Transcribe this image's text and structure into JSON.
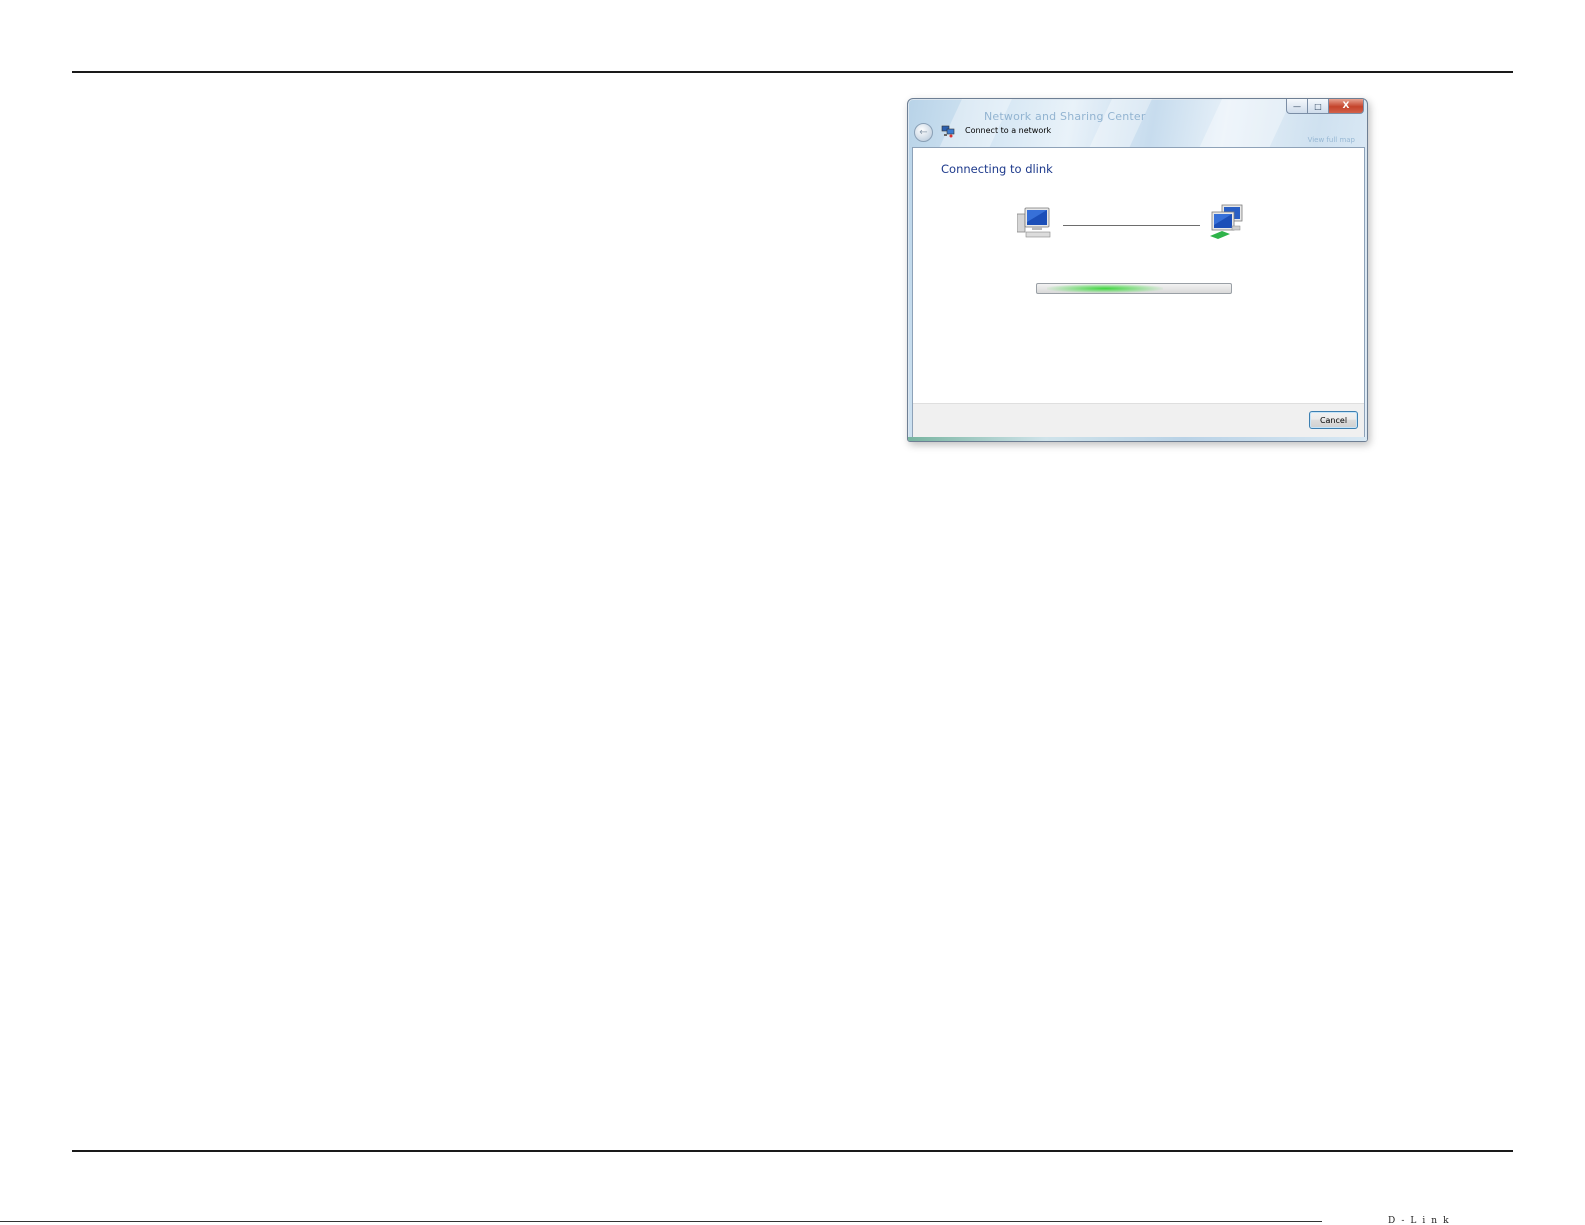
{
  "dialog": {
    "window_title": "Network and Sharing Center",
    "title_link": "View full map",
    "breadcrumb": "Connect to a network",
    "heading": "Connecting to dlink",
    "cancel_label": "Cancel",
    "caption": {
      "minimize": "—",
      "maximize": "□",
      "close": "X"
    },
    "back_glyph": "←",
    "progress_fraction": 0.35
  },
  "icons": [
    "back-arrow-icon",
    "network-icon",
    "computer-icon",
    "network-computers-icon"
  ],
  "footer": {
    "page_label": "D-Link"
  }
}
